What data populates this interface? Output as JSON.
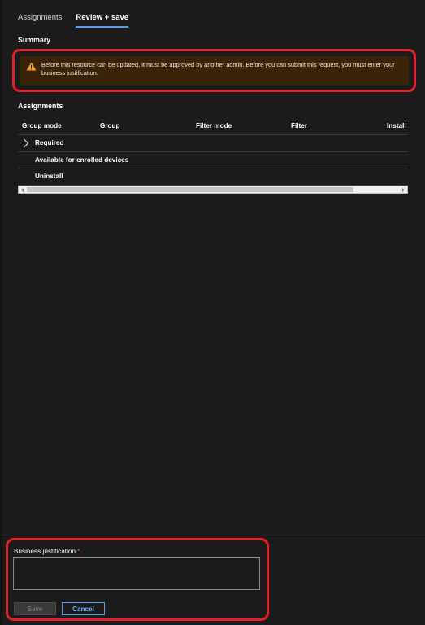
{
  "tabs": [
    {
      "label": "Assignments",
      "active": false
    },
    {
      "label": "Review + save",
      "active": true
    }
  ],
  "summary": {
    "title": "Summary",
    "warning_icon": "warning-triangle-icon",
    "warning_text": "Before this resource can be updated, it must be approved by another admin. Before you can submit this request, you must enter your business justification."
  },
  "assignments": {
    "title": "Assignments",
    "columns": [
      "Group mode",
      "Group",
      "Filter mode",
      "Filter",
      "Install c"
    ],
    "rows": [
      {
        "label": "Required",
        "expandable": true
      },
      {
        "label": "Available for enrolled devices",
        "expandable": false
      },
      {
        "label": "Uninstall",
        "expandable": false
      }
    ]
  },
  "justification": {
    "label": "Business justification",
    "required_marker": "*",
    "value": "",
    "placeholder": ""
  },
  "buttons": {
    "save": "Save",
    "cancel": "Cancel"
  },
  "colors": {
    "background": "#1b1b1b",
    "accent": "#4f9ff0",
    "warning_bg": "#3a2306",
    "warning_icon": "#f0a030",
    "highlight_outline": "#e3202e"
  }
}
